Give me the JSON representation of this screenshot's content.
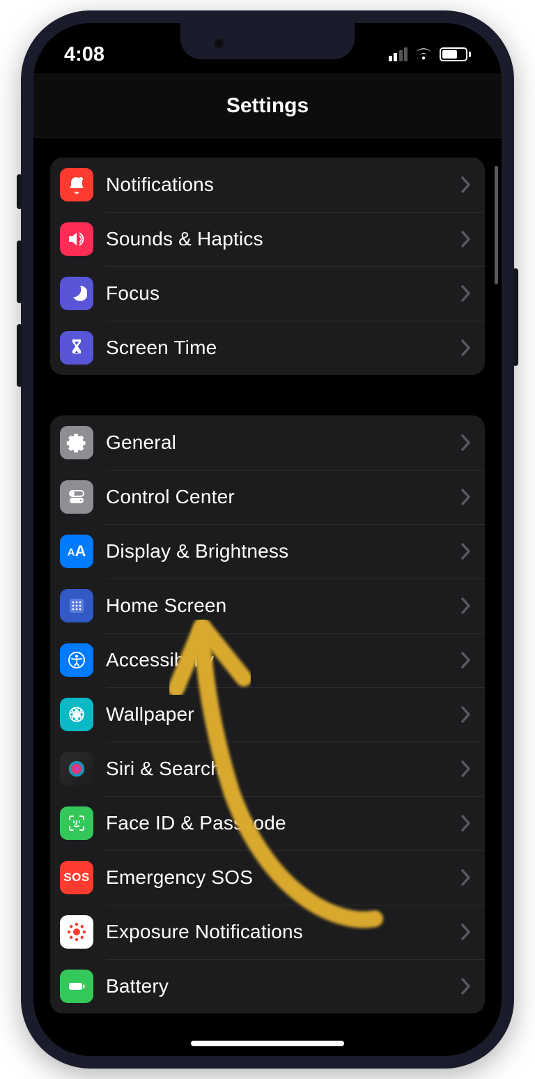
{
  "status": {
    "time": "4:08"
  },
  "header": {
    "title": "Settings"
  },
  "groups": [
    {
      "rows": [
        {
          "id": "notifications",
          "label": "Notifications",
          "icon": "notifications-icon",
          "color": "c-notif"
        },
        {
          "id": "sounds-haptics",
          "label": "Sounds & Haptics",
          "icon": "sounds-icon",
          "color": "c-sound"
        },
        {
          "id": "focus",
          "label": "Focus",
          "icon": "focus-icon",
          "color": "c-focus"
        },
        {
          "id": "screen-time",
          "label": "Screen Time",
          "icon": "screen-time-icon",
          "color": "c-screentime"
        }
      ]
    },
    {
      "rows": [
        {
          "id": "general",
          "label": "General",
          "icon": "general-icon",
          "color": "c-general"
        },
        {
          "id": "control-center",
          "label": "Control Center",
          "icon": "control-center-icon",
          "color": "c-control"
        },
        {
          "id": "display",
          "label": "Display & Brightness",
          "icon": "display-icon",
          "color": "c-display"
        },
        {
          "id": "home-screen",
          "label": "Home Screen",
          "icon": "home-screen-icon",
          "color": "c-home"
        },
        {
          "id": "accessibility",
          "label": "Accessibility",
          "icon": "accessibility-icon",
          "color": "c-access"
        },
        {
          "id": "wallpaper",
          "label": "Wallpaper",
          "icon": "wallpaper-icon",
          "color": "c-wall"
        },
        {
          "id": "siri-search",
          "label": "Siri & Search",
          "icon": "siri-icon",
          "color": "c-siri"
        },
        {
          "id": "faceid",
          "label": "Face ID & Passcode",
          "icon": "faceid-icon",
          "color": "c-faceid"
        },
        {
          "id": "emergency-sos",
          "label": "Emergency SOS",
          "icon": "sos-icon",
          "color": "c-sos"
        },
        {
          "id": "exposure",
          "label": "Exposure Notifications",
          "icon": "exposure-icon",
          "color": "c-exposure"
        },
        {
          "id": "battery",
          "label": "Battery",
          "icon": "battery-icon",
          "color": "c-battery"
        }
      ]
    }
  ]
}
